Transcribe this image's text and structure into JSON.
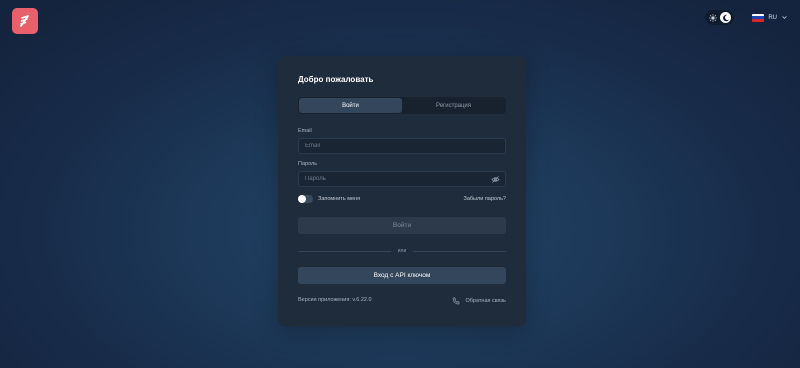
{
  "header": {
    "logo_icon": "feather-logo-icon",
    "brand_color": "#e8606a",
    "theme_toggle": {
      "light_icon": "sun-icon",
      "dark_icon": "moon-icon",
      "selected": "dark"
    },
    "language": {
      "code": "RU",
      "flag_icon": "russia-flag-icon"
    }
  },
  "login": {
    "title": "Добро пожаловать",
    "tabs": [
      {
        "label": "Войти",
        "active": true
      },
      {
        "label": "Регистрация",
        "active": false
      }
    ],
    "email": {
      "label": "Email",
      "placeholder": "Email",
      "value": ""
    },
    "password": {
      "label": "Пароль",
      "placeholder": "Пароль",
      "value": "",
      "toggle_icon": "eye-off-icon"
    },
    "remember_label": "Запомнить меня",
    "remember_checked": false,
    "forgot_label": "Забыли пароль?",
    "submit_label": "Войти",
    "divider_label": "или",
    "api_key_label": "Вход с API ключом",
    "version_text": "Версия приложения: v.6.22.0",
    "feedback_label": "Обратная связь",
    "feedback_icon": "phone-icon"
  },
  "colors": {
    "card_bg": "#1f2c3c",
    "accent_button": "#34465c",
    "page_bg": "#1c3656"
  }
}
